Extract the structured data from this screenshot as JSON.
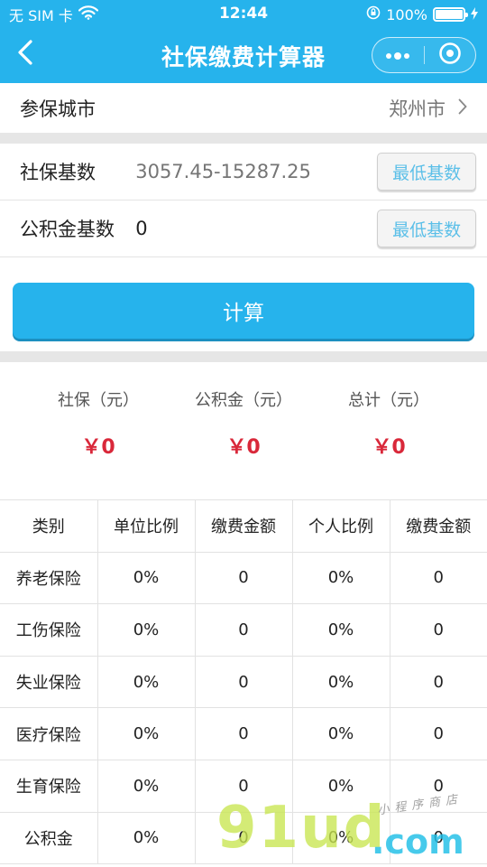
{
  "status_bar": {
    "carrier": "无 SIM 卡",
    "time": "12:44",
    "battery_percent": "100%"
  },
  "nav": {
    "title": "社保缴费计算器"
  },
  "city": {
    "label": "参保城市",
    "value": "郑州市"
  },
  "social_base": {
    "label": "社保基数",
    "placeholder": "3057.45-15287.25",
    "button": "最低基数"
  },
  "fund_base": {
    "label": "公积金基数",
    "value": "0",
    "button": "最低基数"
  },
  "calculate_label": "计算",
  "summary": [
    {
      "label": "社保（元）",
      "value": "￥0"
    },
    {
      "label": "公积金（元）",
      "value": "￥0"
    },
    {
      "label": "总计（元）",
      "value": "￥0"
    }
  ],
  "table": {
    "headers": [
      "类别",
      "单位比例",
      "缴费金额",
      "个人比例",
      "缴费金额"
    ],
    "rows": [
      [
        "养老保险",
        "0%",
        "0",
        "0%",
        "0"
      ],
      [
        "工伤保险",
        "0%",
        "0",
        "0%",
        "0"
      ],
      [
        "失业保险",
        "0%",
        "0",
        "0%",
        "0"
      ],
      [
        "医疗保险",
        "0%",
        "0",
        "0%",
        "0"
      ],
      [
        "生育保险",
        "0%",
        "0",
        "0%",
        "0"
      ],
      [
        "公积金",
        "0%",
        "0",
        "0%",
        "0"
      ]
    ]
  },
  "watermark": {
    "main": "91ud",
    "suffix": ".com",
    "small": "小程序商店"
  },
  "colors": {
    "brand": "#26b3ec",
    "amount_red": "#d9283a",
    "button_text": "#5bbfe8"
  }
}
